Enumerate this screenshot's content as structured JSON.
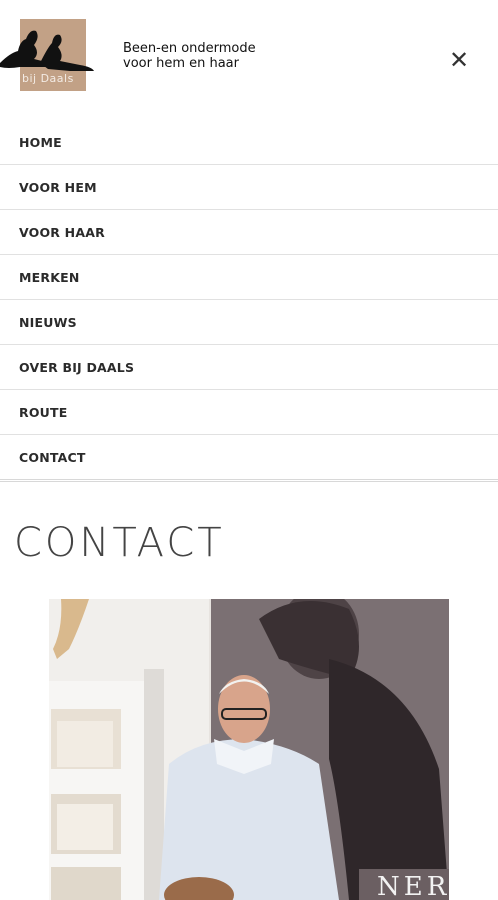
{
  "header": {
    "logo_text": "bij Daals",
    "tagline_line1": "Been-en ondermode",
    "tagline_line2": "voor hem en haar",
    "close_icon": "close-icon"
  },
  "nav": {
    "items": [
      {
        "label": "HOME"
      },
      {
        "label": "VOOR HEM"
      },
      {
        "label": "VOOR HAAR"
      },
      {
        "label": "MERKEN"
      },
      {
        "label": "NIEUWS"
      },
      {
        "label": "OVER BIJ DAALS"
      },
      {
        "label": "ROUTE"
      },
      {
        "label": "CONTACT"
      }
    ]
  },
  "main": {
    "title": "CONTACT",
    "photo_poster_text": "NERT"
  },
  "colors": {
    "logo_bg": "#c2a186",
    "text": "#2b2b2b",
    "divider": "#e1e1e1"
  }
}
